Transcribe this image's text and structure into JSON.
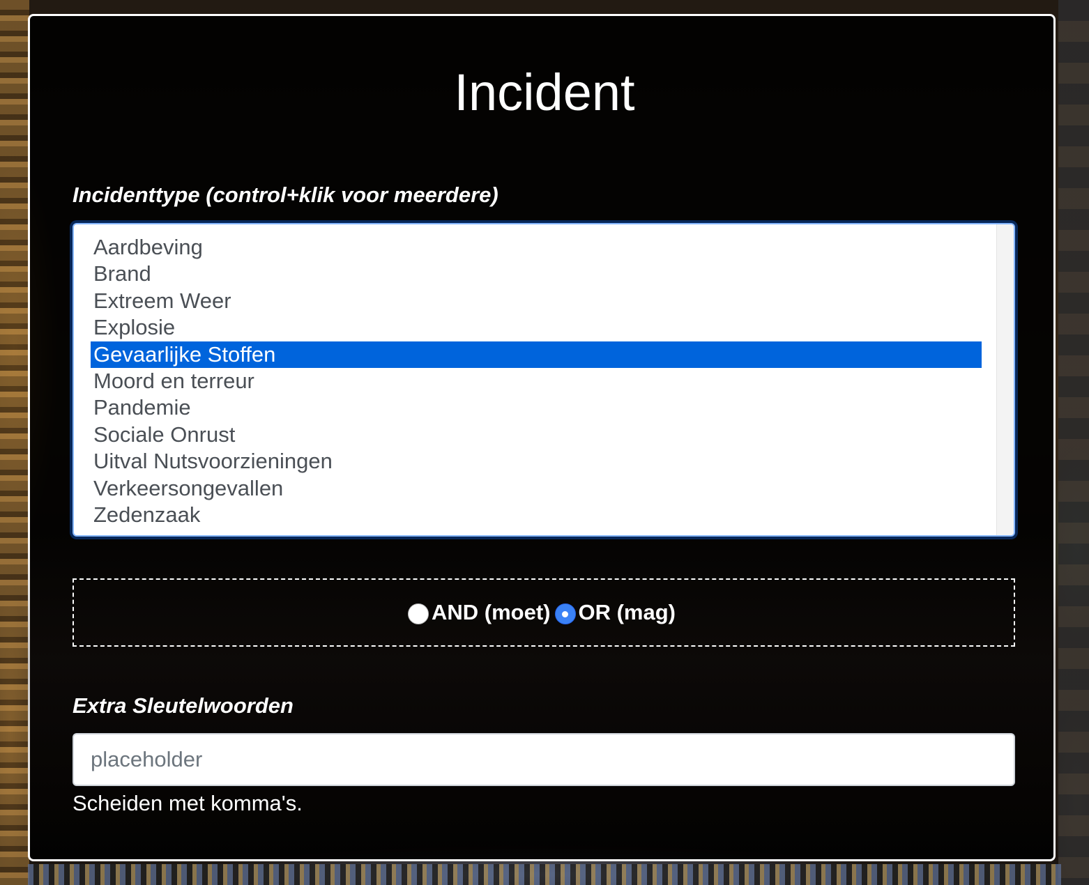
{
  "page": {
    "title": "Incident"
  },
  "incident_type": {
    "label": "Incidenttype (control+klik voor meerdere)",
    "options": [
      {
        "label": "Aardbeving",
        "selected": false
      },
      {
        "label": "Brand",
        "selected": false
      },
      {
        "label": "Extreem Weer",
        "selected": false
      },
      {
        "label": "Explosie",
        "selected": false
      },
      {
        "label": "Gevaarlijke Stoffen",
        "selected": true
      },
      {
        "label": "Moord en terreur",
        "selected": false
      },
      {
        "label": "Pandemie",
        "selected": false
      },
      {
        "label": "Sociale Onrust",
        "selected": false
      },
      {
        "label": "Uitval Nutsvoorzieningen",
        "selected": false
      },
      {
        "label": "Verkeersongevallen",
        "selected": false
      },
      {
        "label": "Zedenzaak",
        "selected": false
      }
    ]
  },
  "logic": {
    "and_label": "AND (moet)",
    "or_label": "OR (mag)",
    "selected": "or"
  },
  "keywords": {
    "label": "Extra Sleutelwoorden",
    "placeholder": "placeholder",
    "value": "",
    "help": "Scheiden met komma's."
  },
  "colors": {
    "selection": "#0064dc",
    "radio_checked": "#3b82f6",
    "focus_ring": "#86b7fe"
  }
}
